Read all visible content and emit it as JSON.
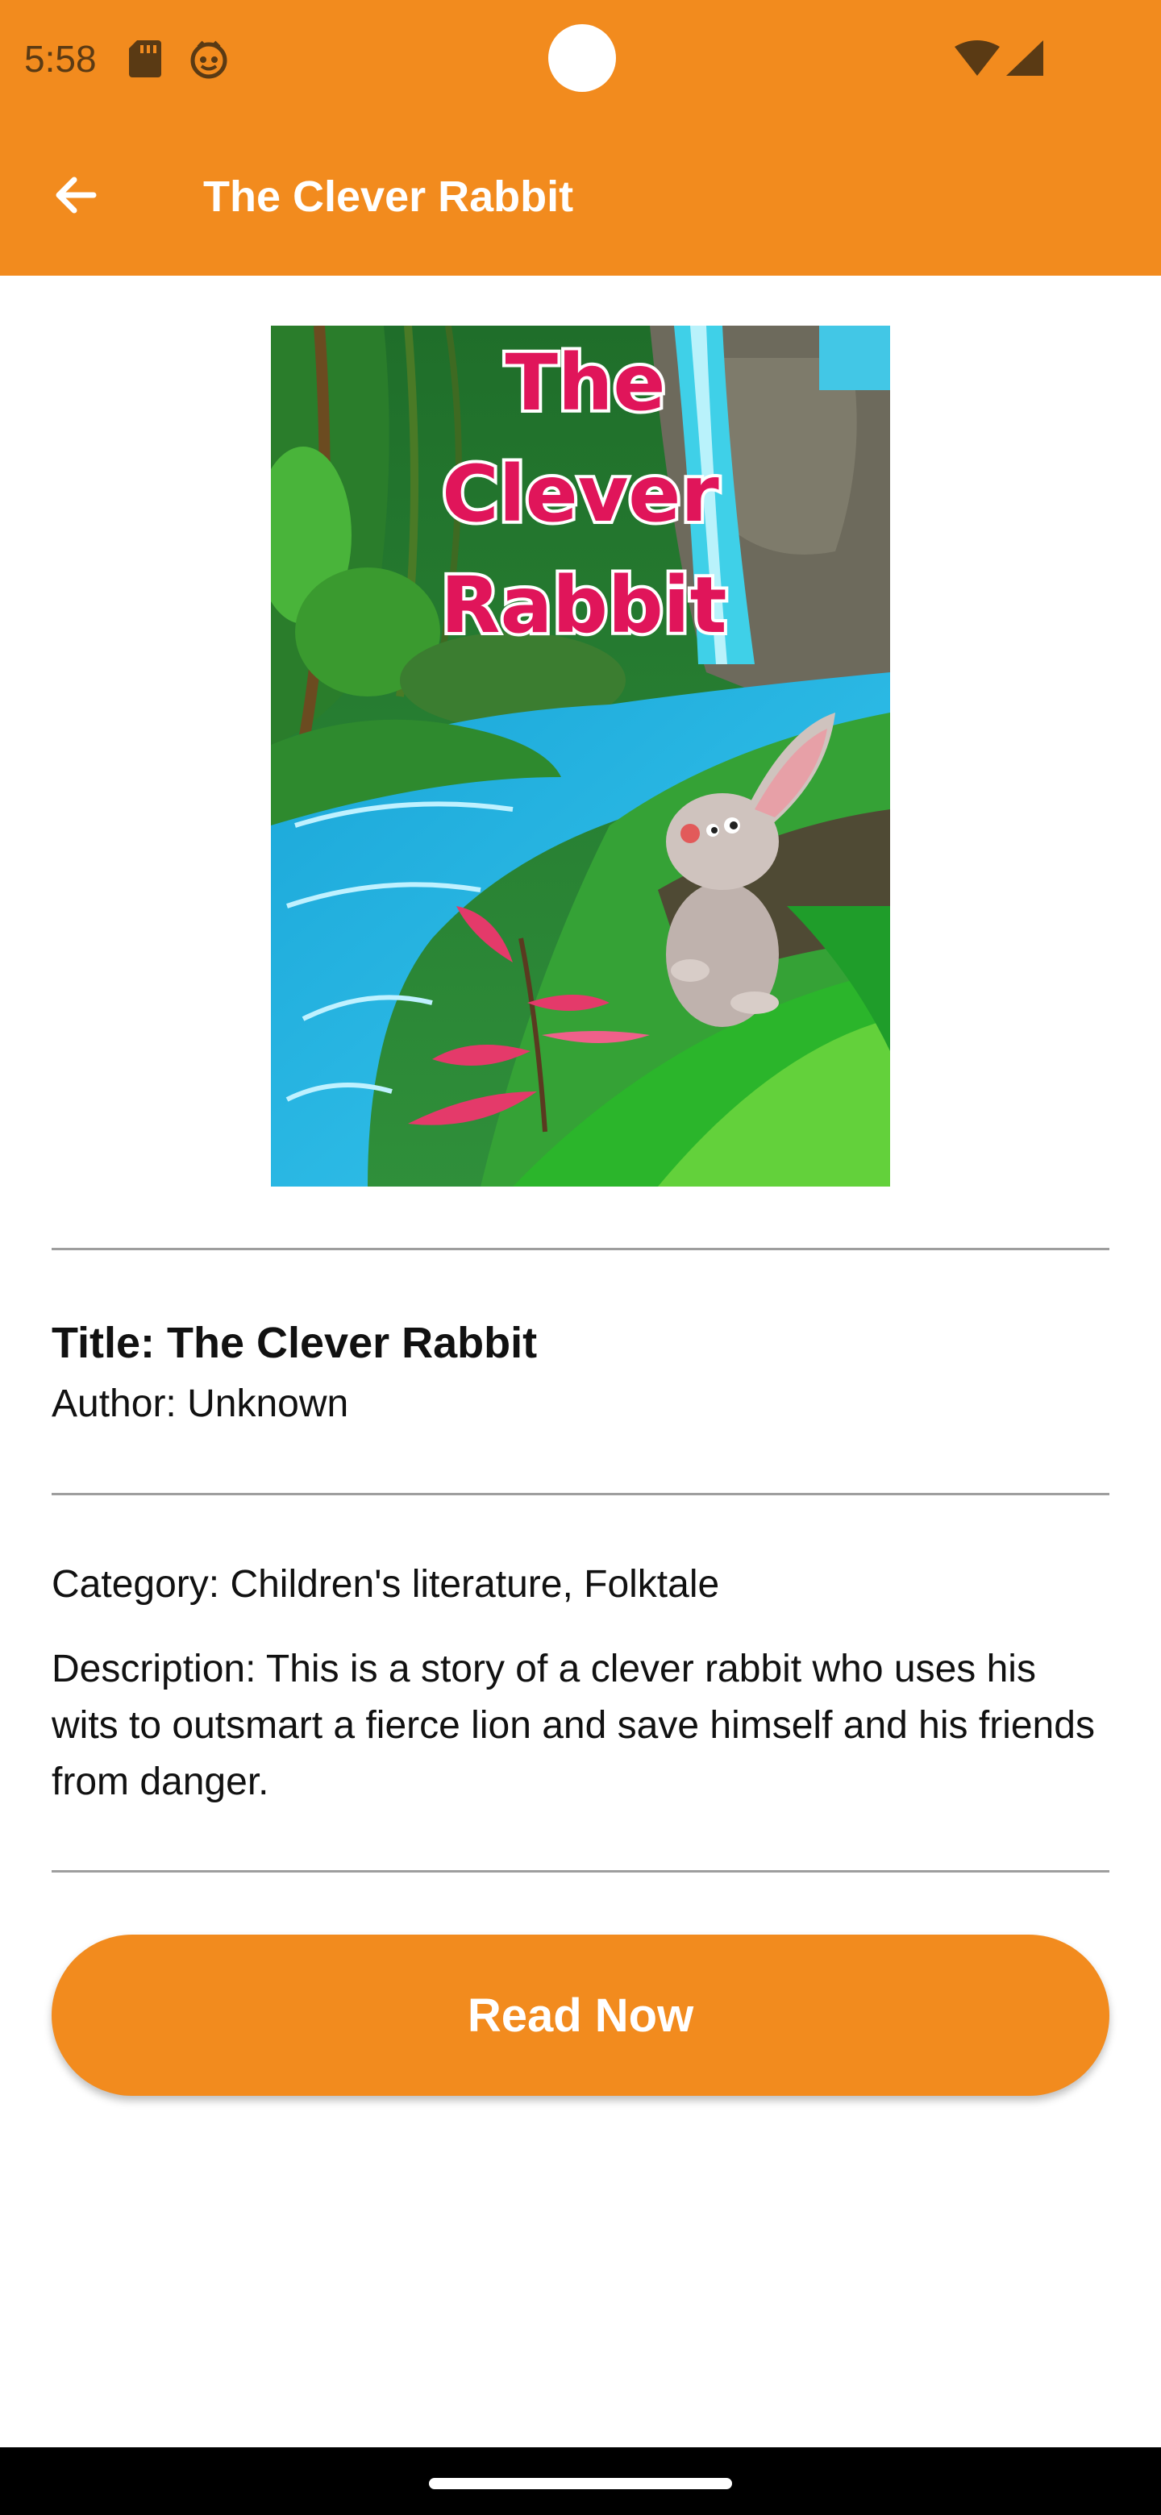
{
  "status_bar": {
    "time": "5:58",
    "icons": [
      "sd-card-icon",
      "bot-icon",
      "wifi-icon",
      "cell-signal-icon"
    ]
  },
  "app_bar": {
    "title": "The Clever Rabbit",
    "back_icon": "arrow-back-icon"
  },
  "cover": {
    "title_lines": [
      "The",
      "Clever",
      "Rabbit"
    ]
  },
  "book": {
    "title": "Title: The Clever Rabbit",
    "author": "Author: Unknown",
    "category": "Category: Children's literature, Folktale",
    "description": "Description: This is a story of a clever rabbit who uses his wits to outsmart a fierce lion and save himself and his friends from danger."
  },
  "actions": {
    "read_label": "Read Now"
  },
  "colors": {
    "accent": "#f28b1e",
    "cover_title": "#e0155a",
    "divider": "#9e9e9e"
  }
}
